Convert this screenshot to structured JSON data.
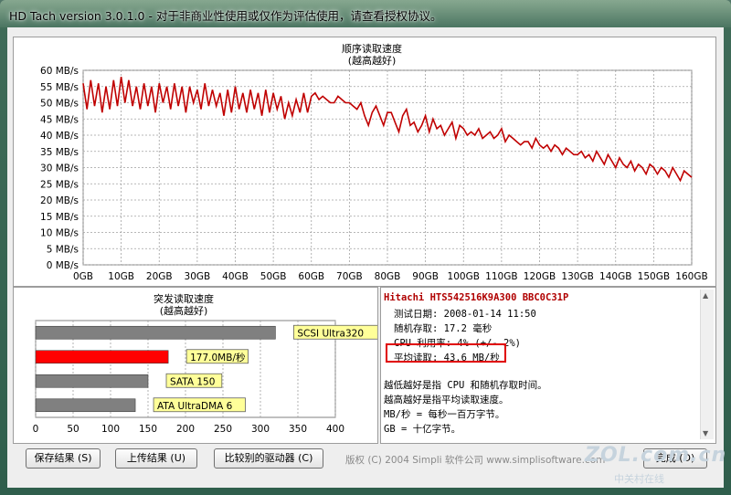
{
  "window": {
    "title": "HD Tach version 3.0.1.0  - 对于非商业性使用或仅作为评估使用，请查看授权协议。"
  },
  "sequential": {
    "title": "顺序读取速度",
    "subtitle": "(越高越好)"
  },
  "burst": {
    "title": "突发读取速度",
    "subtitle": "(越高越好)"
  },
  "chart_data": [
    {
      "type": "line",
      "title": "顺序读取速度",
      "subtitle": "(越高越好)",
      "x_unit": "GB",
      "y_unit": "MB/s",
      "xlim": [
        0,
        160
      ],
      "ylim": [
        0,
        60
      ],
      "x_ticks": [
        "0GB",
        "10GB",
        "20GB",
        "30GB",
        "40GB",
        "50GB",
        "60GB",
        "70GB",
        "80GB",
        "90GB",
        "100GB",
        "110GB",
        "120GB",
        "130GB",
        "140GB",
        "150GB",
        "160GB"
      ],
      "y_ticks": [
        "0 MB/s",
        "5 MB/s",
        "10 MB/s",
        "15 MB/s",
        "20 MB/s",
        "25 MB/s",
        "30 MB/s",
        "35 MB/s",
        "40 MB/s",
        "45 MB/s",
        "50 MB/s",
        "55 MB/s",
        "60 MB/s"
      ],
      "grid": true,
      "color": "#c00000",
      "series": [
        {
          "x": [
            0,
            1,
            2,
            3,
            4,
            5,
            6,
            7,
            8,
            9,
            10,
            11,
            12,
            13,
            14,
            15,
            16,
            17,
            18,
            19,
            20,
            21,
            22,
            23,
            24,
            25,
            26,
            27,
            28,
            29,
            30,
            31,
            32,
            33,
            34,
            35,
            36,
            37,
            38,
            39,
            40,
            41,
            42,
            43,
            44,
            45,
            46,
            47,
            48,
            49,
            50,
            51,
            52,
            53,
            54,
            55,
            56,
            57,
            58,
            59,
            60,
            61,
            62,
            63,
            64,
            65,
            66,
            67,
            68,
            69,
            70,
            71,
            72,
            73,
            74,
            75,
            76,
            77,
            78,
            79,
            80,
            81,
            82,
            83,
            84,
            85,
            86,
            87,
            88,
            89,
            90,
            91,
            92,
            93,
            94,
            95,
            96,
            97,
            98,
            99,
            100,
            101,
            102,
            103,
            104,
            105,
            106,
            107,
            108,
            109,
            110,
            111,
            112,
            113,
            114,
            115,
            116,
            117,
            118,
            119,
            120,
            121,
            122,
            123,
            124,
            125,
            126,
            127,
            128,
            129,
            130,
            131,
            132,
            133,
            134,
            135,
            136,
            137,
            138,
            139,
            140,
            141,
            142,
            143,
            144,
            145,
            146,
            147,
            148,
            149,
            150,
            151,
            152,
            153,
            154,
            155,
            156,
            157,
            158,
            159,
            160
          ],
          "y": [
            56,
            48,
            57,
            49,
            56,
            47,
            55,
            48,
            57,
            49,
            58,
            50,
            57,
            49,
            55,
            48,
            56,
            49,
            55,
            47,
            56,
            50,
            55,
            48,
            56,
            49,
            55,
            47,
            55,
            50,
            54,
            48,
            56,
            49,
            54,
            49,
            53,
            46,
            54,
            47,
            55,
            48,
            53,
            47,
            54,
            48,
            53,
            46,
            54,
            47,
            53,
            48,
            52,
            45,
            50,
            46,
            51,
            47,
            53,
            47,
            52,
            53,
            51,
            52,
            51,
            50,
            50,
            52,
            51,
            50,
            50,
            49,
            48,
            50,
            46,
            43,
            47,
            49,
            46,
            43,
            47,
            47,
            44,
            41,
            46,
            48,
            43,
            44,
            41,
            43,
            46,
            41,
            45,
            42,
            43,
            40,
            42,
            44,
            39,
            43,
            42,
            40,
            41,
            40,
            42,
            39,
            40,
            41,
            39,
            40,
            42,
            38,
            40,
            39,
            38,
            37,
            38,
            38,
            36,
            39,
            37,
            36,
            37,
            35,
            37,
            36,
            34,
            36,
            35,
            34,
            34,
            35,
            33,
            34,
            32,
            35,
            33,
            31,
            34,
            32,
            30,
            33,
            31,
            30,
            32,
            29,
            31,
            30,
            28,
            31,
            30,
            28,
            30,
            29,
            27,
            30,
            28,
            26,
            29,
            28,
            27
          ]
        }
      ]
    },
    {
      "type": "bar",
      "orientation": "horizontal",
      "title": "突发读取速度",
      "subtitle": "(越高越好)",
      "xlim": [
        0,
        400
      ],
      "x_ticks": [
        "0",
        "50",
        "100",
        "150",
        "200",
        "250",
        "300",
        "350",
        "400"
      ],
      "grid": true,
      "categories": [
        "SCSI Ultra320",
        "177.0MB/秒",
        "SATA 150",
        "ATA UltraDMA 6"
      ],
      "values": [
        320,
        177,
        150,
        133
      ],
      "colors": [
        "#808080",
        "#ff0000",
        "#808080",
        "#808080"
      ],
      "label_bg": "#ffff99"
    }
  ],
  "info": {
    "drive": "Hitachi  HTS542516K9A300  BBC0C31P",
    "date": "测试日期: 2008-01-14     11:50",
    "random_access": "随机存取: 17.2 毫秒",
    "cpu": "CPU 利用率: 4% (+/- 2%)",
    "average": "平均读取: 43.6 MB/秒",
    "note1": "越低越好是指 CPU 和随机存取时间。",
    "note2": "越高越好是指平均读取速度。",
    "note3": "MB/秒 = 每秒一百万字节。",
    "note4": "GB = 十亿字节。",
    "accent": "#e00000"
  },
  "buttons": {
    "save": "保存结果 (S)",
    "upload": "上传结果 (U)",
    "compare": "比较别的驱动器 (C)",
    "done": "完成 (D)"
  },
  "footer": {
    "copyright": "版权 (C) 2004 Simpli 软件公司  www.simplisoftware.com"
  },
  "watermark": {
    "text": "ZOL.com.cn",
    "sub": "中关村在线"
  }
}
